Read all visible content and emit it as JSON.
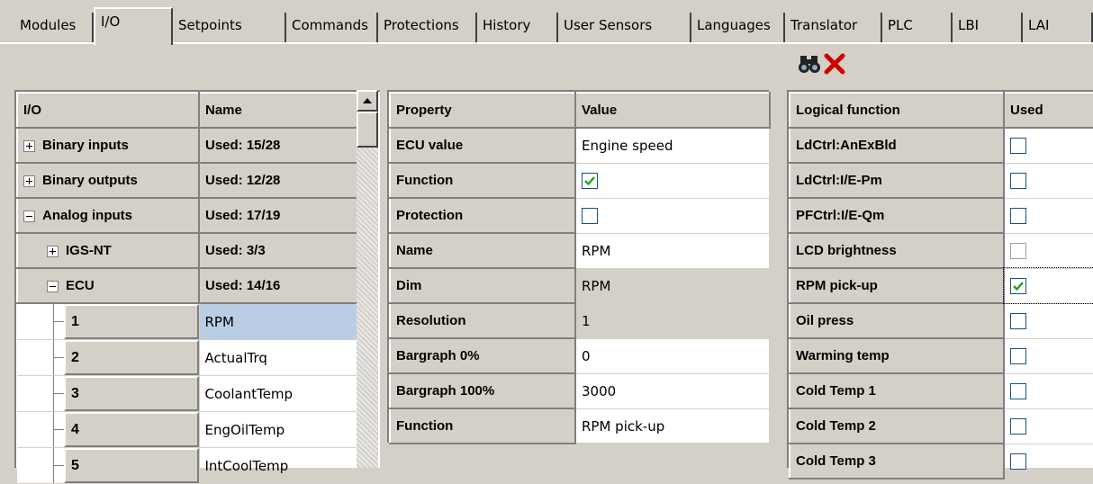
{
  "tabs": [
    {
      "label": "Modules",
      "active": false
    },
    {
      "label": "I/O",
      "active": true
    },
    {
      "label": "Setpoints",
      "active": false
    },
    {
      "label": "Commands",
      "active": false
    },
    {
      "label": "Protections",
      "active": false
    },
    {
      "label": "History",
      "active": false
    },
    {
      "label": "User Sensors",
      "active": false
    },
    {
      "label": "Languages",
      "active": false
    },
    {
      "label": "Translator",
      "active": false
    },
    {
      "label": "PLC",
      "active": false
    },
    {
      "label": "LBI",
      "active": false
    },
    {
      "label": "LAI",
      "active": false
    }
  ],
  "toolbar": {
    "find_icon": "binoculars-icon",
    "delete_icon": "red-x-icon"
  },
  "io_grid": {
    "headers": {
      "io": "I/O",
      "name": "Name"
    },
    "groups": [
      {
        "label": "Binary inputs",
        "used": "Used: 15/28",
        "expander": "plus"
      },
      {
        "label": "Binary outputs",
        "used": "Used: 12/28",
        "expander": "plus"
      },
      {
        "label": "Analog inputs",
        "used": "Used: 17/19",
        "expander": "minus"
      },
      {
        "label": "IGS-NT",
        "used": "Used: 3/3",
        "expander": "plus"
      },
      {
        "label": "ECU",
        "used": "Used: 14/16",
        "expander": "minus"
      }
    ],
    "items": [
      {
        "num": "1",
        "name": "RPM",
        "selected": true
      },
      {
        "num": "2",
        "name": "ActualTrq",
        "selected": false
      },
      {
        "num": "3",
        "name": "CoolantTemp",
        "selected": false
      },
      {
        "num": "4",
        "name": "EngOilTemp",
        "selected": false
      },
      {
        "num": "5",
        "name": "IntCoolTemp",
        "selected": false
      }
    ]
  },
  "property_grid": {
    "headers": {
      "property": "Property",
      "value": "Value"
    },
    "rows": [
      {
        "property": "ECU value",
        "value": "Engine speed",
        "type": "text"
      },
      {
        "property": "Function",
        "value": "",
        "type": "checkbox",
        "checked": true
      },
      {
        "property": "Protection",
        "value": "",
        "type": "checkbox",
        "checked": false
      },
      {
        "property": "Name",
        "value": "RPM",
        "type": "text"
      },
      {
        "property": "Dim",
        "value": "RPM",
        "type": "readonly"
      },
      {
        "property": "Resolution",
        "value": "1",
        "type": "readonly"
      },
      {
        "property": "Bargraph 0%",
        "value": "0",
        "type": "text"
      },
      {
        "property": "Bargraph 100%",
        "value": "3000",
        "type": "text"
      },
      {
        "property": "Function",
        "value": "RPM pick-up",
        "type": "text"
      }
    ]
  },
  "logical_grid": {
    "headers": {
      "function": "Logical function",
      "used": "Used"
    },
    "rows": [
      {
        "function": "LdCtrl:AnExBld",
        "used": false
      },
      {
        "function": "LdCtrl:I/E-Pm",
        "used": false
      },
      {
        "function": "PFCtrl:I/E-Qm",
        "used": false
      },
      {
        "function": "LCD brightness",
        "used": false
      },
      {
        "function": "RPM pick-up",
        "used": true
      },
      {
        "function": "Oil press",
        "used": false
      },
      {
        "function": "Warming temp",
        "used": false
      },
      {
        "function": "Cold Temp 1",
        "used": false
      },
      {
        "function": "Cold Temp 2",
        "used": false
      },
      {
        "function": "Cold Temp 3",
        "used": false
      }
    ]
  },
  "colors": {
    "face": "#d4d0c8",
    "selection": "#b9cde5",
    "check": "#21a121",
    "delete": "#d00000"
  }
}
